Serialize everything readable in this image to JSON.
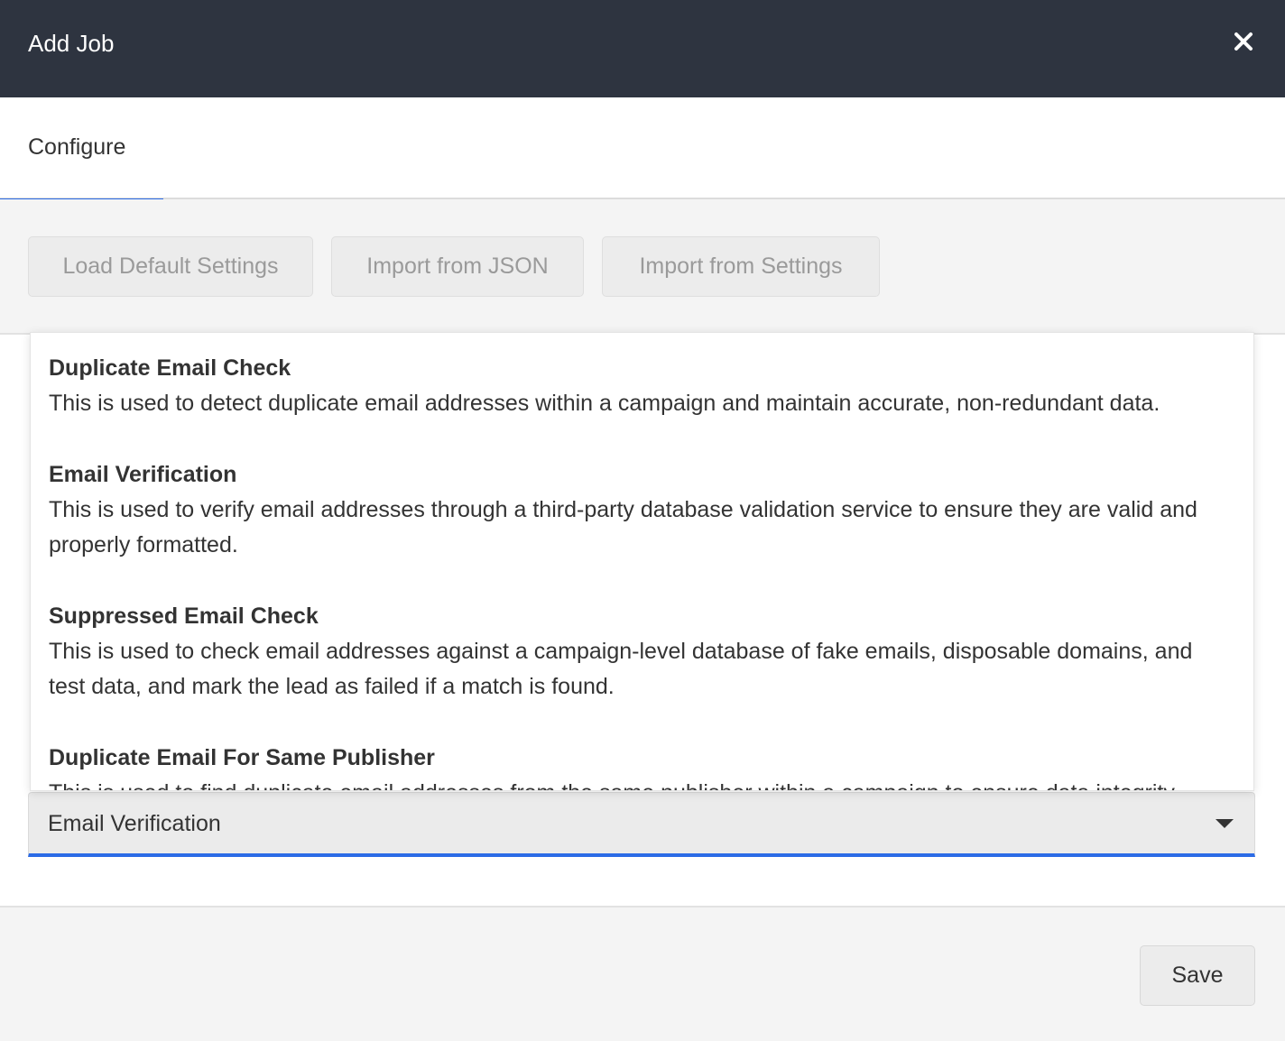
{
  "header": {
    "title": "Add Job",
    "close_icon": "close-icon"
  },
  "tabs": [
    {
      "label": "Configure",
      "active": true
    }
  ],
  "toolbar": {
    "load_default": "Load Default Settings",
    "import_json": "Import from JSON",
    "import_settings": "Import from Settings"
  },
  "dropdown": {
    "options": [
      {
        "title": "Duplicate Email Check",
        "desc": "This is used to detect duplicate email addresses within a campaign and maintain accurate, non-redundant data."
      },
      {
        "title": "Email Verification",
        "desc": "This is used to verify email addresses through a third-party database validation service to ensure they are valid and properly formatted."
      },
      {
        "title": "Suppressed Email Check",
        "desc": "This is used to check email addresses against a campaign-level database of fake emails, disposable domains, and test data, and mark the lead as failed if a match is found."
      },
      {
        "title": "Duplicate Email For Same Publisher",
        "desc": "This is used to find duplicate email addresses from the same publisher within a campaign to ensure data integrity."
      }
    ]
  },
  "select": {
    "value": "Email Verification"
  },
  "footer": {
    "save_label": "Save"
  },
  "colors": {
    "header_bg": "#2e3440",
    "accent": "#2b6be6"
  }
}
